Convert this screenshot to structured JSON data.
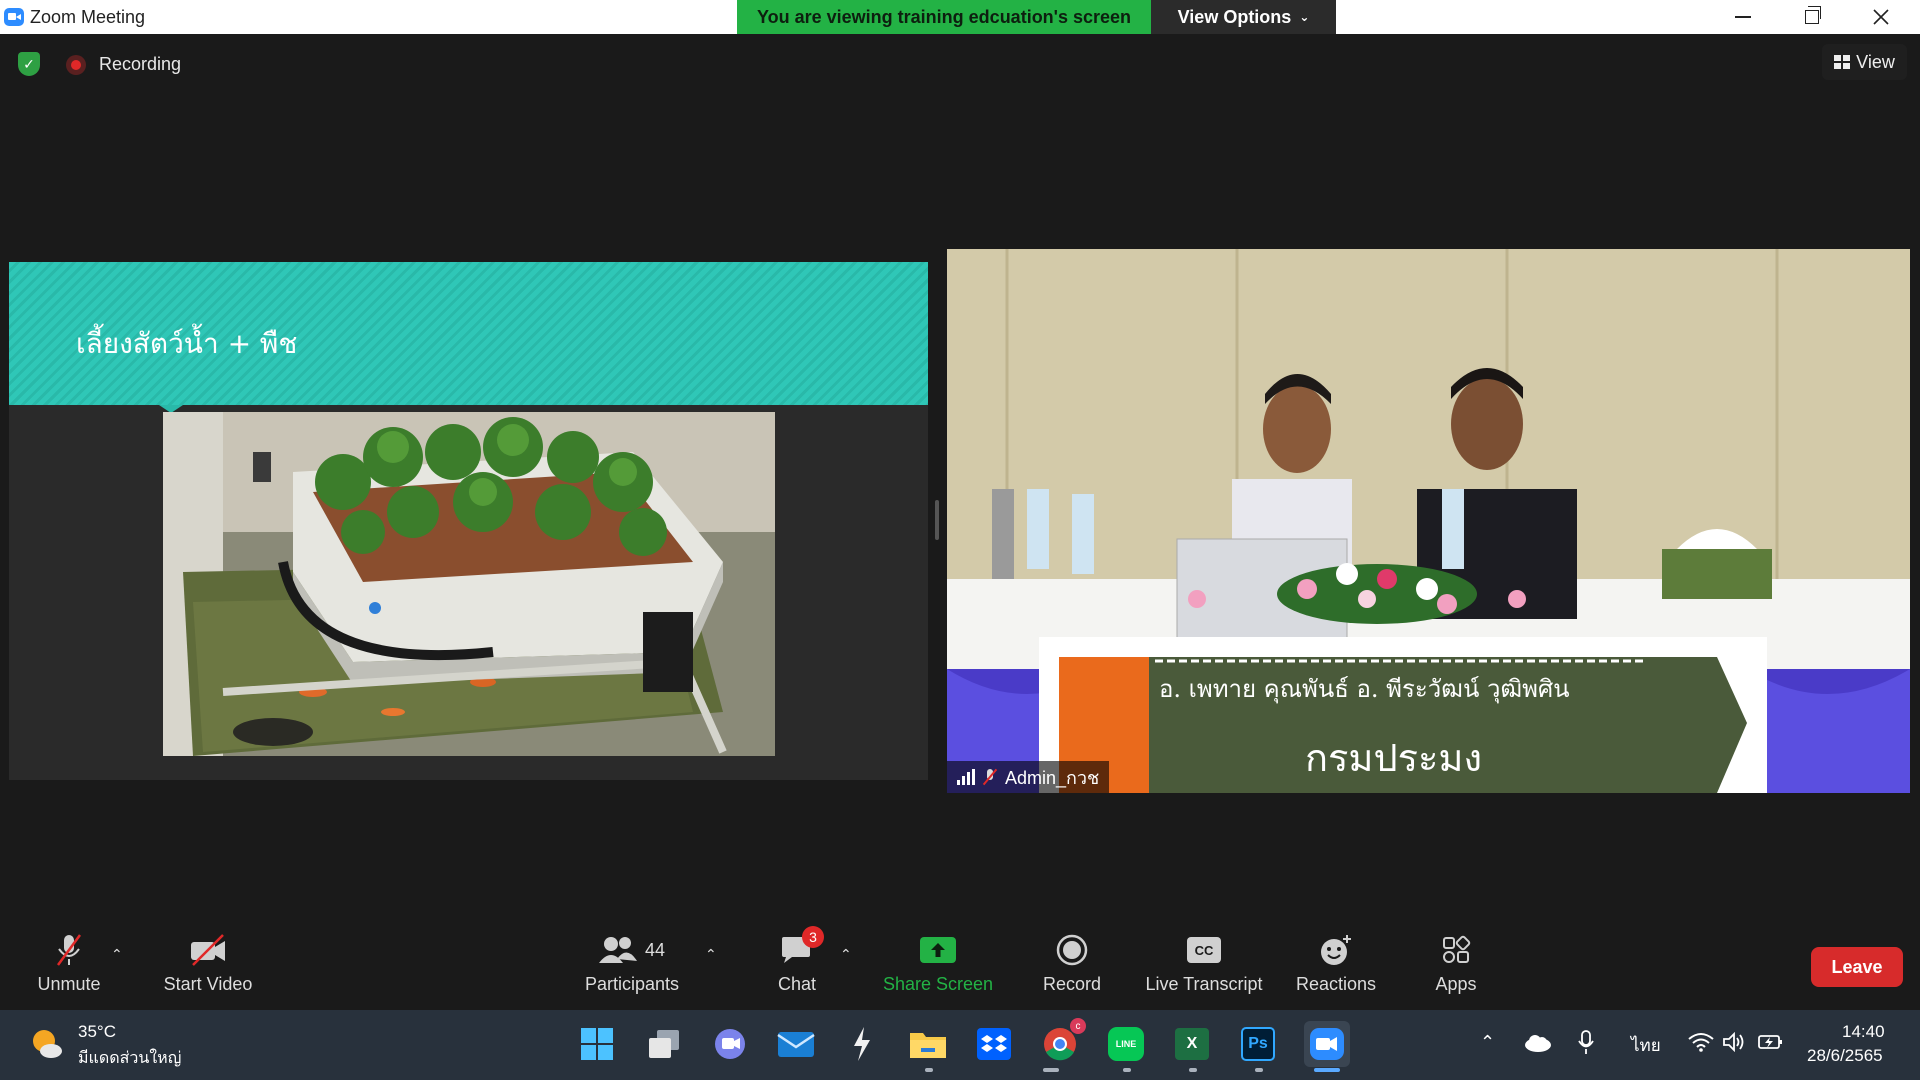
{
  "window": {
    "title": "Zoom Meeting",
    "viewing_banner": "You are viewing training edcuation's screen",
    "view_options_label": "View Options"
  },
  "top_overlay": {
    "recording_label": "Recording",
    "view_label": "View"
  },
  "shared_screen": {
    "slide_title": "เลี้ยงสัตว์น้ำ + พืช"
  },
  "video": {
    "participant_name": "Admin_กวช",
    "banner_names": "อ. เพทาย  คุณพันธ์          อ. พีระวัฒน์  วุฒิพศิน",
    "banner_org": "กรมประมง"
  },
  "toolbar": {
    "unmute_label": "Unmute",
    "start_video_label": "Start Video",
    "participants_label": "Participants",
    "participants_count": "44",
    "chat_label": "Chat",
    "chat_badge": "3",
    "share_screen_label": "Share Screen",
    "record_label": "Record",
    "live_transcript_label": "Live Transcript",
    "cc_text": "CC",
    "reactions_label": "Reactions",
    "apps_label": "Apps",
    "leave_label": "Leave"
  },
  "taskbar": {
    "weather_temp": "35°C",
    "weather_desc": "มีแดดส่วนใหญ่",
    "ps_label": "Ps",
    "line_label": "LINE",
    "excel_label": "X",
    "chrome_badge": "c",
    "language": "ไทย",
    "time": "14:40",
    "date": "28/6/2565"
  },
  "colors": {
    "zoom_blue": "#2D8CFF",
    "banner_green": "#23b245",
    "leave_red": "#d72b2b",
    "slide_teal": "#2fc7b7",
    "toolbar_bg": "#1a1a1a",
    "taskbar_bg": "#28313c"
  }
}
